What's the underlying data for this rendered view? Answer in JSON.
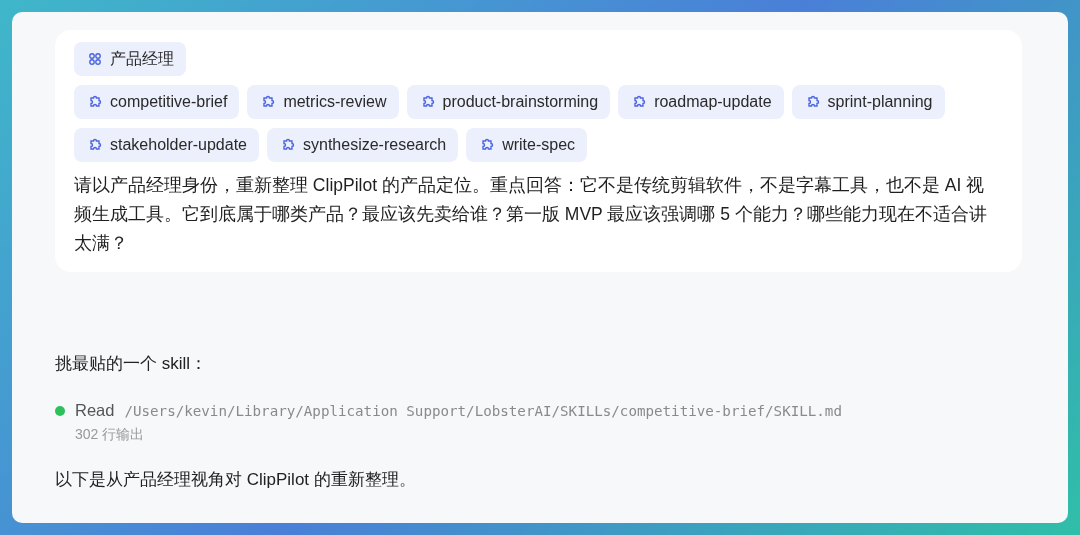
{
  "message": {
    "tags": [
      {
        "kind": "role",
        "label": "产品经理"
      }
    ],
    "skills": [
      {
        "kind": "skill",
        "label": "competitive-brief"
      },
      {
        "kind": "skill",
        "label": "metrics-review"
      },
      {
        "kind": "skill",
        "label": "product-brainstorming"
      },
      {
        "kind": "skill",
        "label": "roadmap-update"
      },
      {
        "kind": "skill",
        "label": "sprint-planning"
      },
      {
        "kind": "skill",
        "label": "stakeholder-update"
      },
      {
        "kind": "skill",
        "label": "synthesize-research"
      },
      {
        "kind": "skill",
        "label": "write-spec"
      }
    ],
    "text": "请以产品经理身份，重新整理 ClipPilot 的产品定位。重点回答：它不是传统剪辑软件，不是字幕工具，也不是 AI 视频生成工具。它到底属于哪类产品？最应该先卖给谁？第一版 MVP 最应该强调哪 5 个能力？哪些能力现在不适合讲太满？"
  },
  "reply": {
    "intro": "挑最贴的一个 skill：",
    "tool_call": {
      "done": true,
      "action": "Read",
      "path": "/Users/kevin/Library/Application Support/LobsterAI/SKILLs/competitive-brief/SKILL.md",
      "summary": "302 行输出"
    },
    "outro": "以下是从产品经理视角对 ClipPilot 的重新整理。"
  }
}
